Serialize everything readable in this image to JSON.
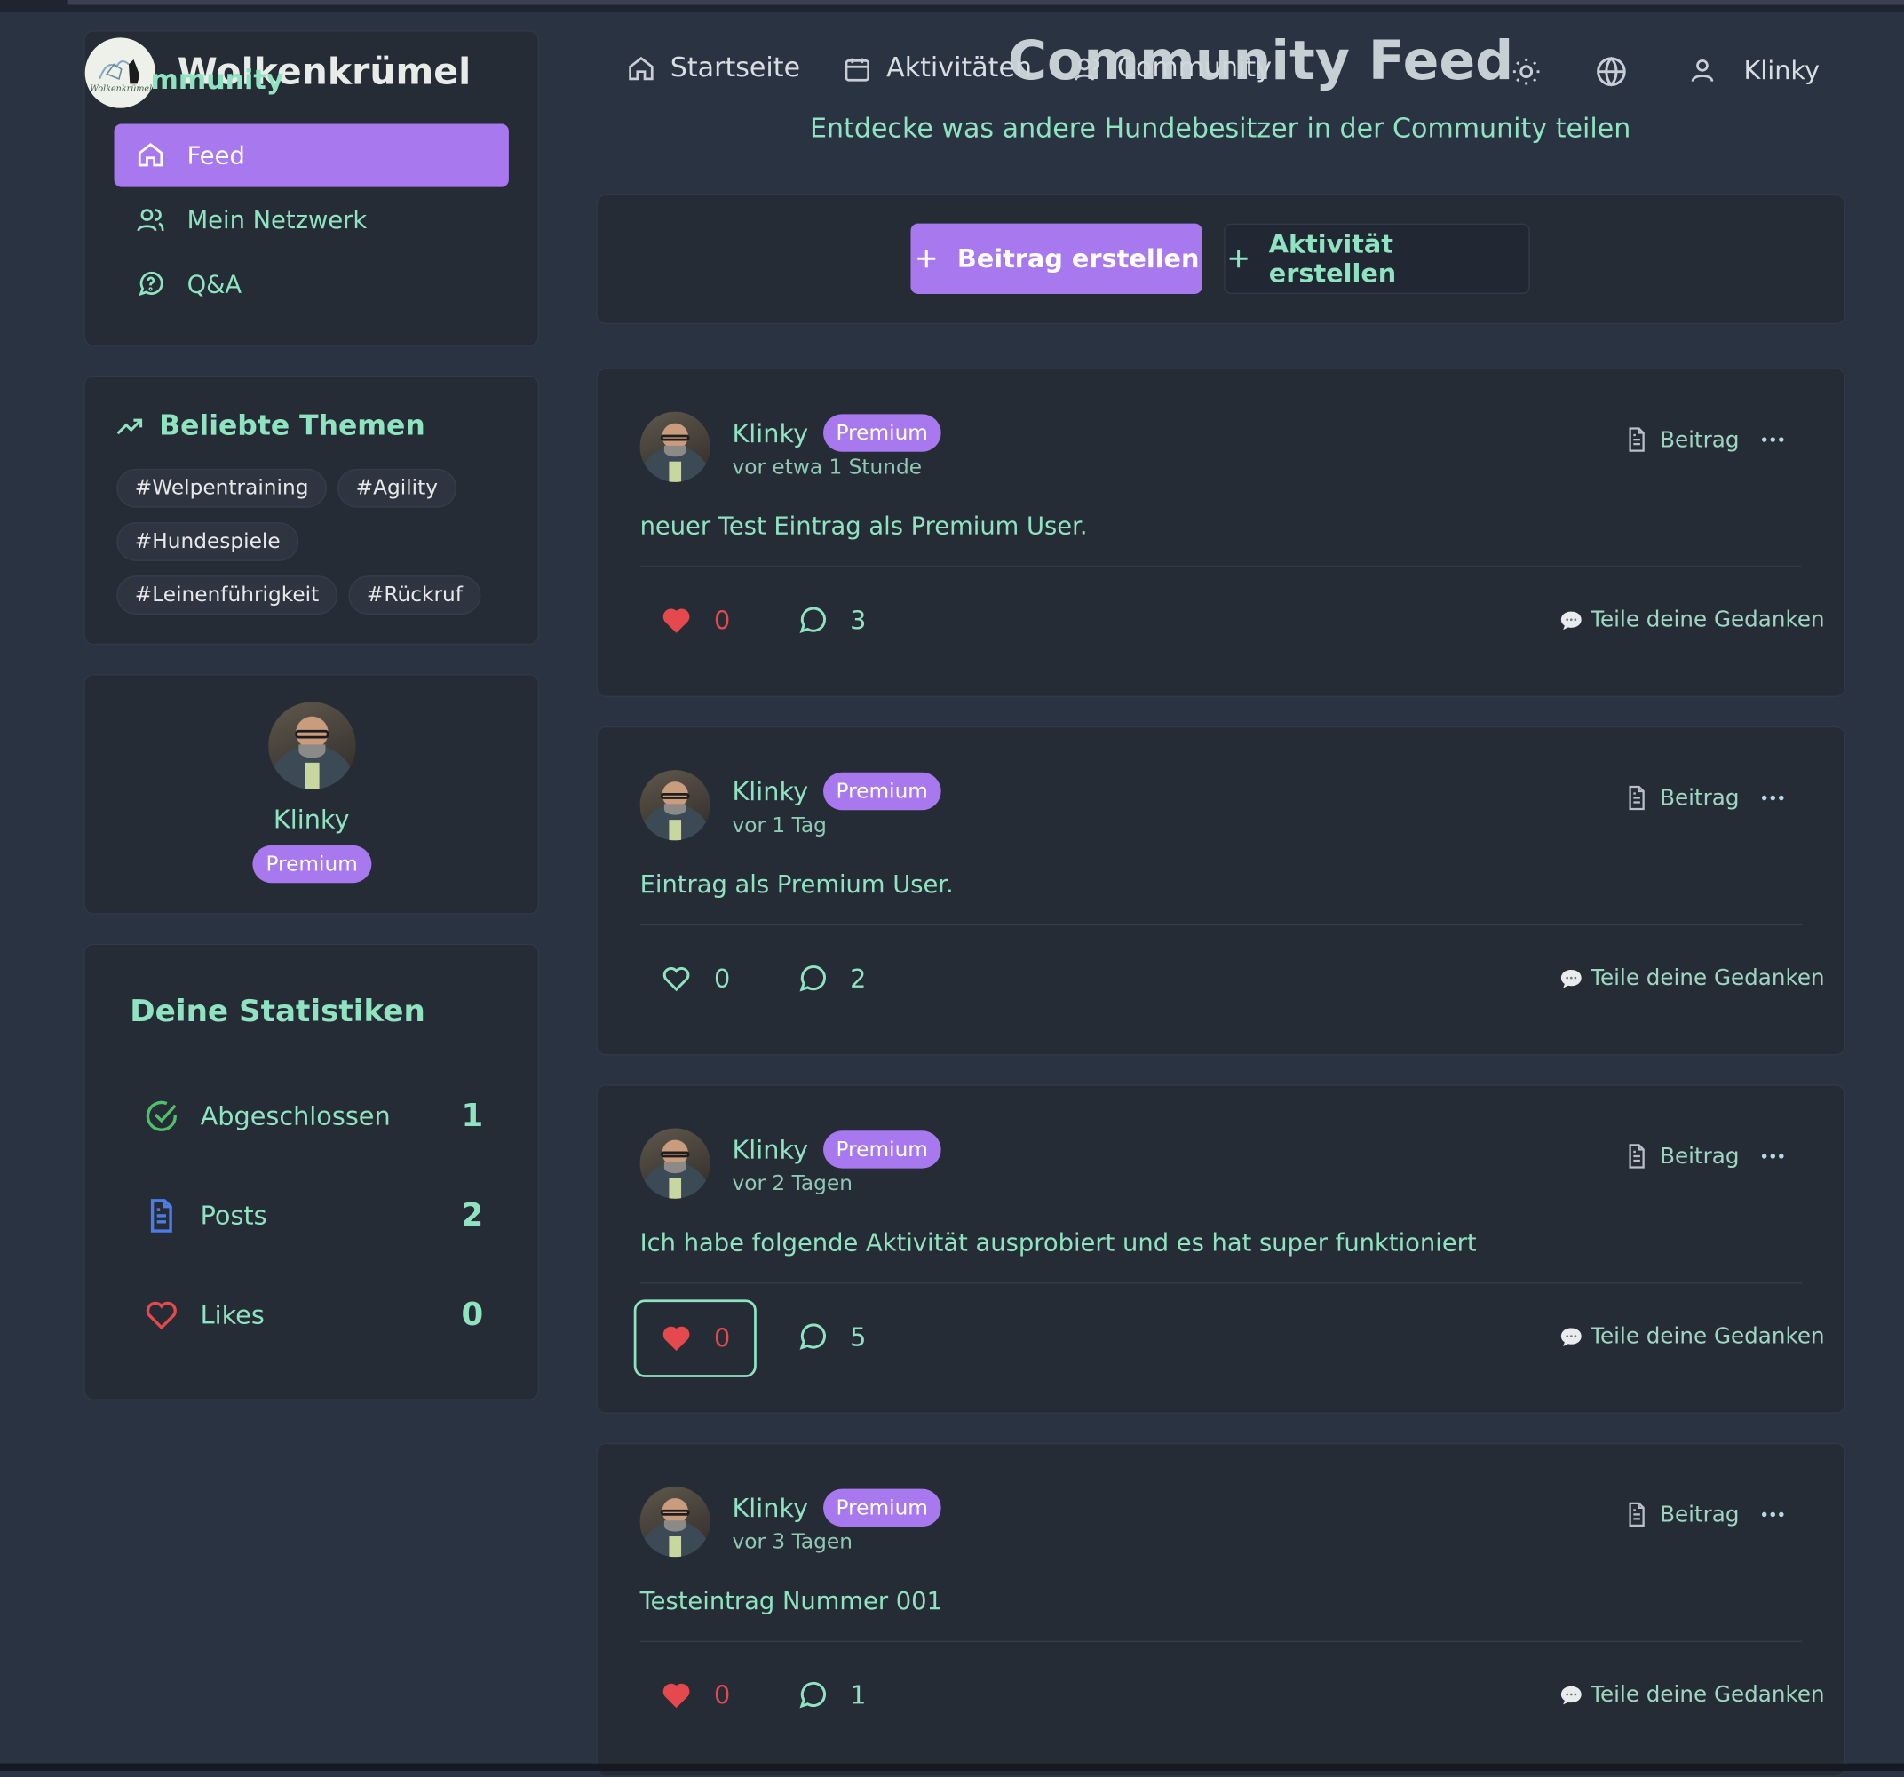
{
  "brand": {
    "name": "Wolkenkrümel",
    "overlap_text": "mmunity",
    "logo_text": "Wolkenkrümel"
  },
  "nav": {
    "items": [
      {
        "label": "Startseite",
        "icon": "home-icon"
      },
      {
        "label": "Aktivitäten",
        "icon": "calendar-icon"
      },
      {
        "label": "Community",
        "icon": "users-icon"
      }
    ],
    "user_label": "Klinky"
  },
  "page": {
    "title": "Community Feed",
    "subtitle": "Entdecke was andere Hundebesitzer in der Community teilen"
  },
  "sidebar": {
    "menu": [
      {
        "label": "Feed",
        "icon": "home-icon",
        "active": true
      },
      {
        "label": "Mein Netzwerk",
        "icon": "users-icon",
        "active": false
      },
      {
        "label": "Q&A",
        "icon": "chat-question-icon",
        "active": false
      }
    ],
    "topics": {
      "title": "Beliebte Themen",
      "tags": [
        "#Welpentraining",
        "#Agility",
        "#Hundespiele",
        "#Leinenführigkeit",
        "#Rückruf"
      ]
    },
    "profile": {
      "name": "Klinky",
      "badge": "Premium"
    },
    "stats": {
      "title": "Deine Statistiken",
      "items": [
        {
          "label": "Abgeschlossen",
          "value": "1",
          "icon": "check-circle-icon",
          "color": "#4fbf6a"
        },
        {
          "label": "Posts",
          "value": "2",
          "icon": "document-icon",
          "color": "#4a7de8"
        },
        {
          "label": "Likes",
          "value": "0",
          "icon": "heart-icon",
          "color": "#e5484d"
        }
      ]
    }
  },
  "actions": {
    "create_post": "Beitrag erstellen",
    "create_activity": "Aktivität erstellen"
  },
  "posts": [
    {
      "author": "Klinky",
      "badge": "Premium",
      "time": "vor etwa 1 Stunde",
      "type": "Beitrag",
      "text": "neuer Test Eintrag als Premium User.",
      "likes": "0",
      "liked": true,
      "comments": "3",
      "share": "Teile deine Gedanken"
    },
    {
      "author": "Klinky",
      "badge": "Premium",
      "time": "vor 1 Tag",
      "type": "Beitrag",
      "text": "Eintrag als Premium User.",
      "likes": "0",
      "liked": false,
      "comments": "2",
      "share": "Teile deine Gedanken"
    },
    {
      "author": "Klinky",
      "badge": "Premium",
      "time": "vor 2 Tagen",
      "type": "Beitrag",
      "text": "Ich habe folgende Aktivität ausprobiert und es hat super funktioniert",
      "likes": "0",
      "liked": true,
      "comments": "5",
      "share": "Teile deine Gedanken"
    },
    {
      "author": "Klinky",
      "badge": "Premium",
      "time": "vor 3 Tagen",
      "type": "Beitrag",
      "text": "Testeintrag Nummer 001",
      "likes": "0",
      "liked": true,
      "comments": "1",
      "share": "Teile deine Gedanken"
    }
  ]
}
